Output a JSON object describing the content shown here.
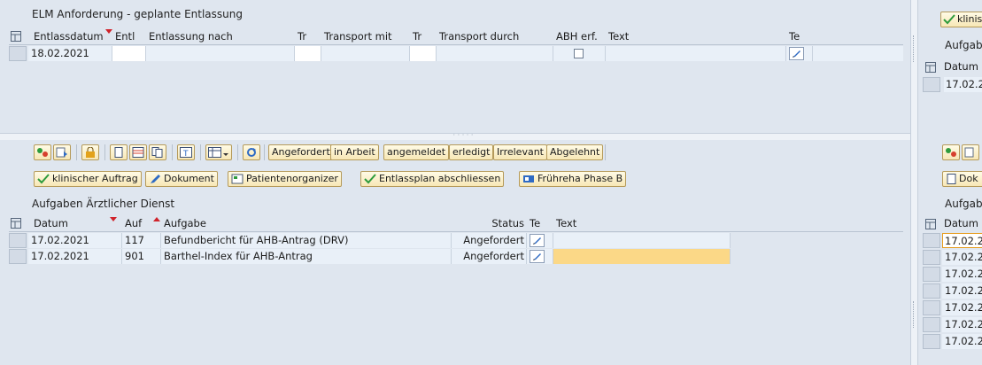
{
  "top_panel": {
    "title": "ELM Anforderung - geplante Entlassung",
    "columns": [
      "Entlassdatum",
      "Entl",
      "Entlassung nach",
      "Tr",
      "Transport mit",
      "Tr",
      "Transport durch",
      "ABH erf.",
      "Text",
      "Te"
    ],
    "row": {
      "entlassdatum": "18.02.2021",
      "abh_erf": false
    }
  },
  "toolbar": {
    "status_buttons": [
      "Angefordert",
      "in Arbeit",
      "angemeldet",
      "erledigt",
      "Irrelevant",
      "Abgelehnt"
    ],
    "action_buttons": [
      "klinischer Auftrag",
      "Dokument",
      "Patientenorganizer",
      "Entlassplan abschliessen",
      "Frühreha Phase B"
    ]
  },
  "bottom_panel": {
    "title": "Aufgaben Ärztlicher Dienst",
    "columns": [
      "Datum",
      "Auf",
      "Aufgabe",
      "Status",
      "Te",
      "Text"
    ],
    "rows": [
      {
        "datum": "17.02.2021",
        "auf": "117",
        "aufgabe": "Befundbericht für AHB-Antrag (DRV)",
        "status": "Angefordert",
        "text": ""
      },
      {
        "datum": "17.02.2021",
        "auf": "901",
        "aufgabe": "Barthel-Index für AHB-Antrag",
        "status": "Angefordert",
        "text": ""
      }
    ]
  },
  "right_panel": {
    "top_button": "klinis",
    "top_title": "Aufgabe",
    "top_header": "Datum",
    "top_row": "17.02.2",
    "mid_button": "Dok",
    "bottom_title": "Aufgab",
    "bottom_header": "Datum",
    "bottom_rows": [
      "17.02.2",
      "17.02.2",
      "17.02.2",
      "17.02.2",
      "17.02.2",
      "17.02.2",
      "17.02.2"
    ]
  }
}
